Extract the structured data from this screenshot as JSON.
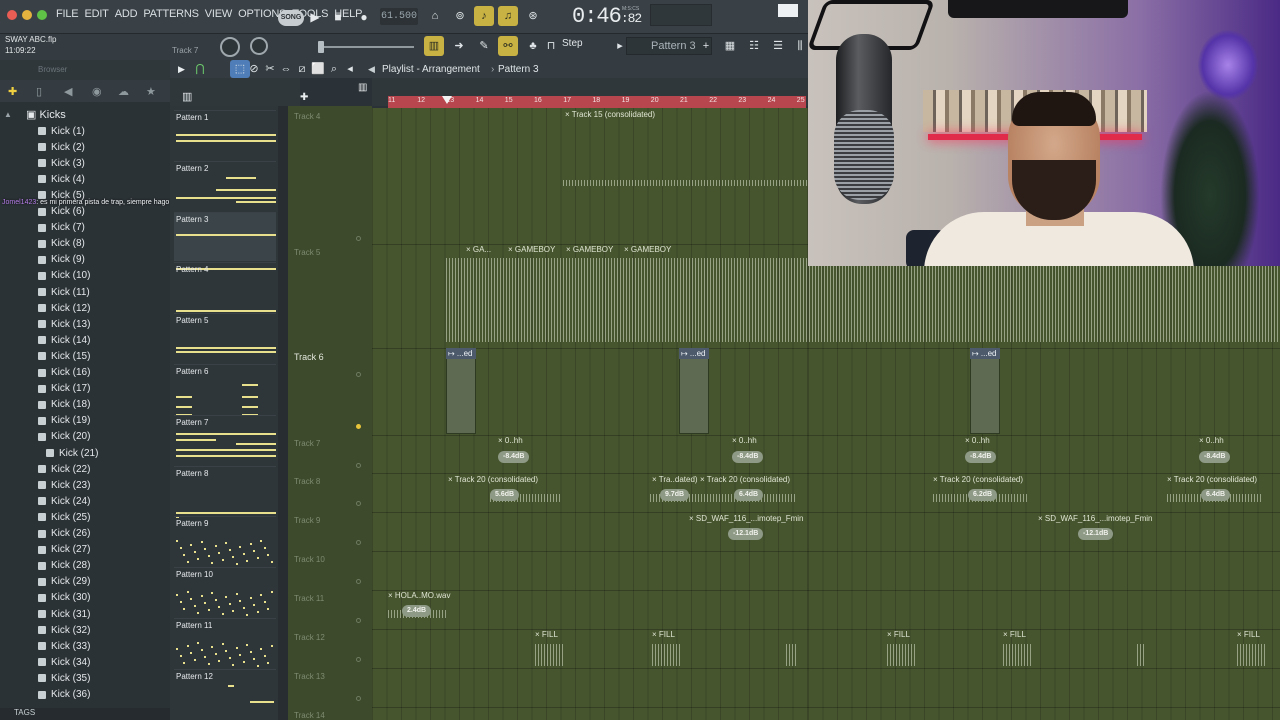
{
  "menu": [
    "FILE",
    "EDIT",
    "ADD",
    "PATTERNS",
    "VIEW",
    "OPTIONS",
    "TOOLS",
    "HELP"
  ],
  "transport": {
    "song_label": "SONG",
    "bpm": "61.500",
    "time": "0:46",
    "time_small": "82",
    "time_unit": "M:S:CS"
  },
  "file": {
    "name": "SWAY ABC.flp",
    "time": "11:09:22",
    "track_hint": "Track 7"
  },
  "toolbar": {
    "step_label": "Step",
    "pattern_selector": "Pattern 3"
  },
  "browser": {
    "title": "Browser",
    "folder": "Kicks",
    "tags_label": "TAGS",
    "items": [
      "Kick (1)",
      "Kick (2)",
      "Kick (3)",
      "Kick (4)",
      "Kick (5)",
      "Kick (6)",
      "Kick (7)",
      "Kick (8)",
      "Kick (9)",
      "Kick (10)",
      "Kick (11)",
      "Kick (12)",
      "Kick (13)",
      "Kick (14)",
      "Kick (15)",
      "Kick (16)",
      "Kick (17)",
      "Kick (18)",
      "Kick (19)",
      "Kick (20)",
      "Kick (21)",
      "Kick (22)",
      "Kick (23)",
      "Kick (24)",
      "Kick (25)",
      "Kick (26)",
      "Kick (27)",
      "Kick (28)",
      "Kick (29)",
      "Kick (30)",
      "Kick (31)",
      "Kick (32)",
      "Kick (33)",
      "Kick (34)",
      "Kick (35)",
      "Kick (36)"
    ]
  },
  "chat": {
    "user": "Jomel1423",
    "message": ": es mi primera pista de trap, siempre hago reggaeton"
  },
  "playlist": {
    "title": "Playlist - Arrangement",
    "breadcrumb": "Pattern 3",
    "ruler": [
      "11",
      "12",
      "13",
      "14",
      "15",
      "16",
      "17",
      "18",
      "19",
      "20",
      "21",
      "22",
      "23",
      "24",
      "25"
    ]
  },
  "patterns": [
    "Pattern 1",
    "Pattern 2",
    "Pattern 3",
    "Pattern 4",
    "Pattern 5",
    "Pattern 6",
    "Pattern 7",
    "Pattern 8",
    "Pattern 9",
    "Pattern 10",
    "Pattern 11",
    "Pattern 12"
  ],
  "tracks": [
    "Track 4",
    "Track 5",
    "Track 6",
    "Track 7",
    "Track 8",
    "Track 9",
    "Track 10",
    "Track 11",
    "Track 12",
    "Track 13",
    "Track 14"
  ],
  "clips": {
    "t4": "Track 15 (consolidated)",
    "t5a": "GA...",
    "t5b": "GAMEBOY",
    "t5c": "GAMEBOY",
    "t5d": "GAMEBOY",
    "ed": "...ed",
    "hh": "0..hh",
    "db_84": "-8.4dB",
    "t8a": "Track 20 (consolidated)",
    "t8b": "Tra..dated)",
    "t8c": "Track 20 (consolidated)",
    "t8d": "Track 20 (consolidated)",
    "t8e": "Track 20 (consolidated)",
    "db56": "5.6dB",
    "db97": "9.7dB",
    "db64": "6.4dB",
    "db62": "6.2dB",
    "t9": "SD_WAF_116_...imotep_Fmin",
    "db121": "-12.1dB",
    "t11": "HOLA..MO.wav",
    "db24": "2.4dB",
    "fill": "FILL"
  }
}
